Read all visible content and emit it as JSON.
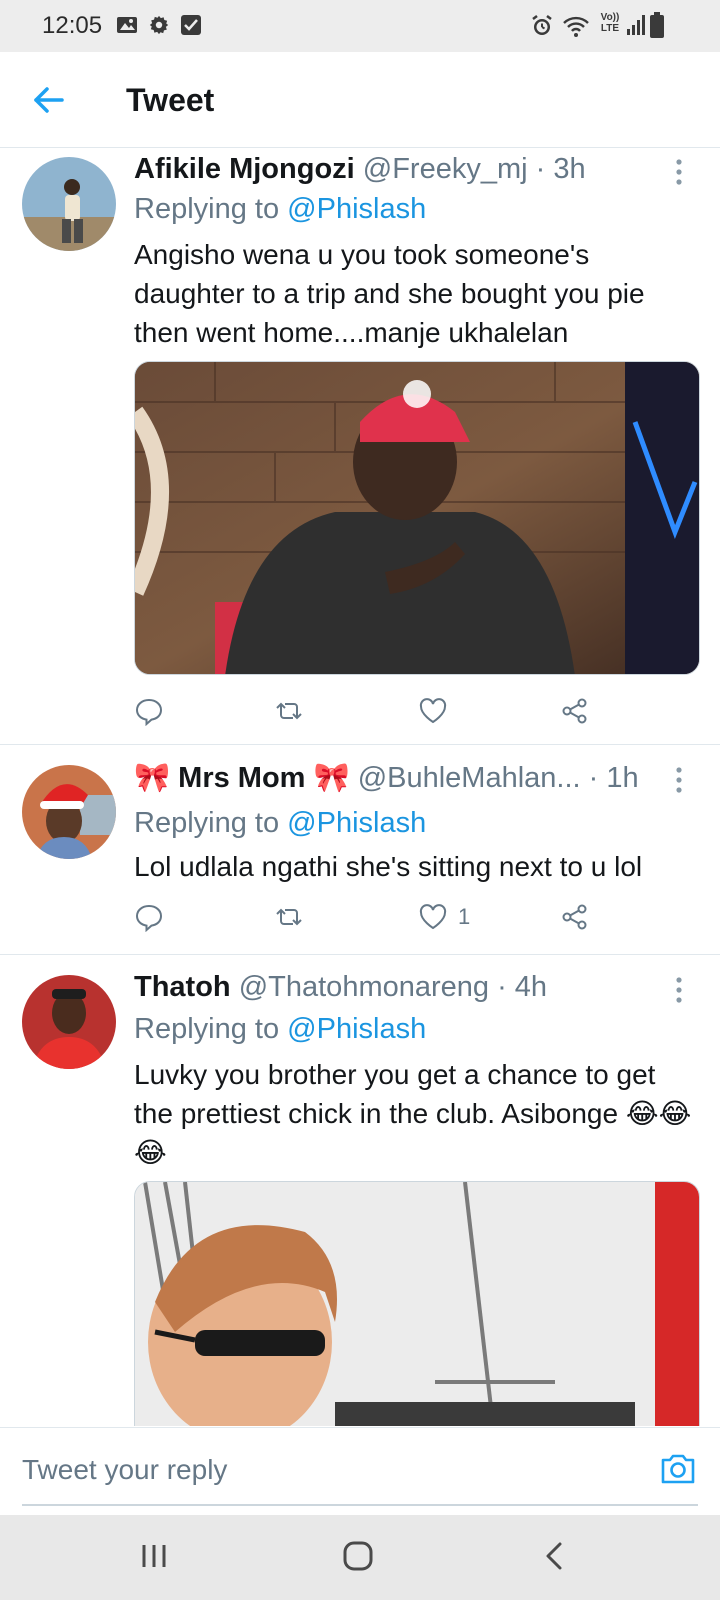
{
  "status_bar": {
    "time": "12:05",
    "left_icons": [
      "image-icon",
      "gear-icon",
      "checkbox-icon"
    ],
    "right_icons": [
      "alarm-icon",
      "wifi-icon",
      "volte-icon",
      "signal-icon",
      "battery-icon"
    ],
    "volte_text": "Vo))\nLTE"
  },
  "header": {
    "title": "Tweet",
    "back_icon": "arrow-left-icon"
  },
  "colors": {
    "accent": "#1da1f2",
    "mention": "#1b95e0",
    "secondary_text": "#657786",
    "divider": "#e1e8ed"
  },
  "tweets": [
    {
      "name": "Afikile Mjongozi",
      "handle": "@Freeky_mj",
      "time": "· 3h",
      "replying_prefix": "Replying to",
      "replying_to": "@Phislash",
      "text": "Angisho wena u you took someone's daughter to a trip and she bought you pie then went home....manje ukhalelan",
      "like_count": ""
    },
    {
      "name": "🎀 Mrs Mom 🎀",
      "handle": "@BuhleMahlan...",
      "time": "· 1h",
      "replying_prefix": "Replying to",
      "replying_to": "@Phislash",
      "text": "Lol udlala ngathi she's sitting next to u lol",
      "like_count": "1"
    },
    {
      "name": "Thatoh",
      "handle": "@Thatohmonareng",
      "time": "· 4h",
      "replying_prefix": "Replying to",
      "replying_to": "@Phislash",
      "text": "Luvky you brother you get a chance to get the prettiest chick in the club. Asibonge 😂😂😂",
      "like_count": ""
    }
  ],
  "compose": {
    "placeholder": "Tweet your reply",
    "camera_icon": "camera-icon"
  },
  "nav_bar": {
    "buttons": [
      "recent-apps-icon",
      "home-icon",
      "back-icon"
    ]
  }
}
